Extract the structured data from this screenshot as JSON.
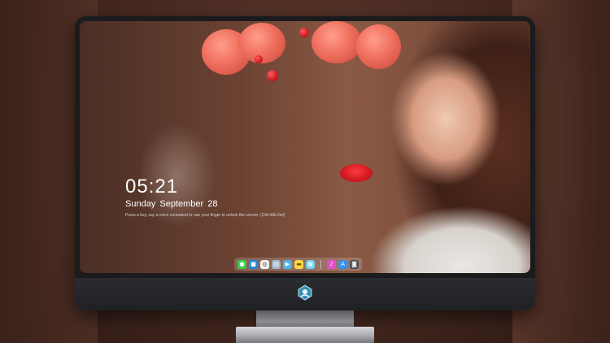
{
  "lockscreen": {
    "time": "05:21",
    "date": "Sunday September  28",
    "hint": "Press a key, say a voice command or use your finger to unlock the screen. (Ctrl+Alt+Del)"
  },
  "dock": {
    "left_apps": [
      {
        "name": "messages-icon",
        "glyph": "●",
        "color": "#3ccf4e"
      },
      {
        "name": "finder-icon",
        "glyph": "■",
        "color": "#1e88e5"
      },
      {
        "name": "safari-icon",
        "glyph": "◎",
        "color": "#f2f2f2"
      },
      {
        "name": "preview-icon",
        "glyph": "▤",
        "color": "#9fb8c8"
      },
      {
        "name": "movie-icon",
        "glyph": "▶",
        "color": "#4fb6e8"
      },
      {
        "name": "notes-icon",
        "glyph": "▬",
        "color": "#ffd84a"
      },
      {
        "name": "photos-icon",
        "glyph": "▦",
        "color": "#6ed3f0"
      }
    ],
    "right_apps": [
      {
        "name": "music-icon",
        "glyph": "♪",
        "color": "#e450c8"
      },
      {
        "name": "app-store-icon",
        "glyph": "A",
        "color": "#3a8ff0"
      },
      {
        "name": "camera-icon",
        "glyph": "◙",
        "color": "#444a52"
      }
    ]
  }
}
